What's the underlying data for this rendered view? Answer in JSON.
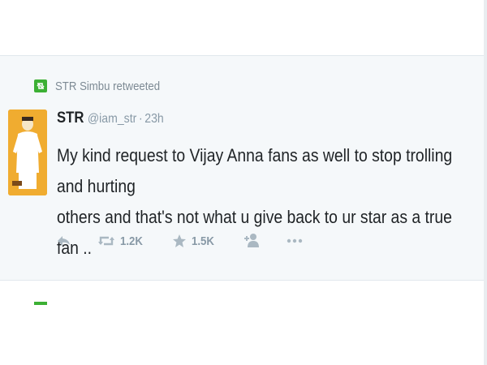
{
  "retweet": {
    "label": "STR Simbu retweeted"
  },
  "tweet": {
    "name": "STR",
    "handle": "@iam_str",
    "separator": "·",
    "time": "23h",
    "line1": "My kind request to Vijay Anna fans as well to stop trolling and hurting",
    "line2": "others and that's not what u give back to ur star as a true fan ..",
    "retweet_count": "1.2K",
    "like_count": "1.5K"
  },
  "avatar": {
    "caption": "STR"
  },
  "colors": {
    "retweet_green": "#3cb034",
    "muted": "#8899a6",
    "text": "#1f2326",
    "band": "#f5f8fa"
  },
  "icons": [
    "retweet-badge-icon",
    "reply-icon",
    "retweet-icon",
    "favorite-star-icon",
    "follow-icon",
    "more-icon"
  ]
}
